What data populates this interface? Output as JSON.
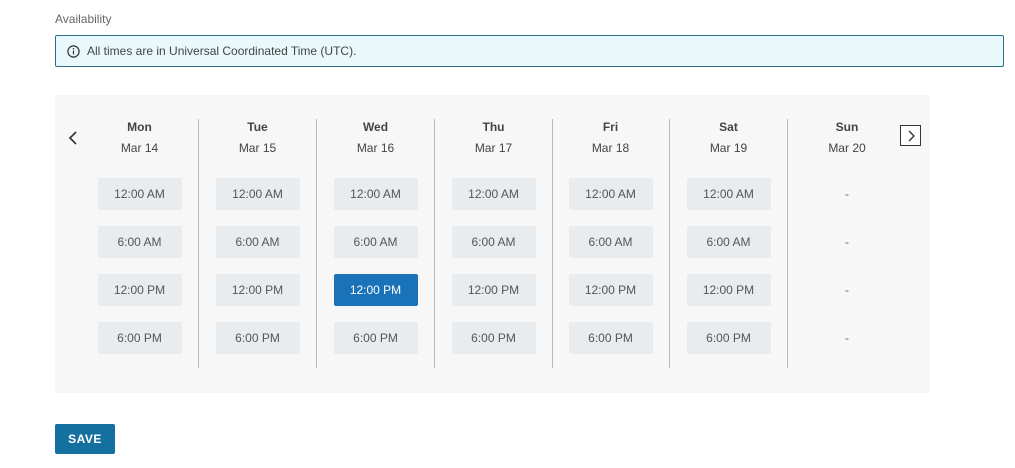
{
  "section_label": "Availability",
  "info_banner": {
    "icon": "info-icon",
    "text": "All times are in Universal Coordinated Time (UTC)."
  },
  "calendar": {
    "prev_icon": "chevron-left-icon",
    "next_icon": "chevron-right-icon",
    "days": [
      {
        "name": "Mon",
        "date": "Mar 14",
        "slots": [
          "12:00 AM",
          "6:00 AM",
          "12:00 PM",
          "6:00 PM"
        ]
      },
      {
        "name": "Tue",
        "date": "Mar 15",
        "slots": [
          "12:00 AM",
          "6:00 AM",
          "12:00 PM",
          "6:00 PM"
        ]
      },
      {
        "name": "Wed",
        "date": "Mar 16",
        "slots": [
          "12:00 AM",
          "6:00 AM",
          "12:00 PM",
          "6:00 PM"
        ],
        "selected_index": 2
      },
      {
        "name": "Thu",
        "date": "Mar 17",
        "slots": [
          "12:00 AM",
          "6:00 AM",
          "12:00 PM",
          "6:00 PM"
        ]
      },
      {
        "name": "Fri",
        "date": "Mar 18",
        "slots": [
          "12:00 AM",
          "6:00 AM",
          "12:00 PM",
          "6:00 PM"
        ]
      },
      {
        "name": "Sat",
        "date": "Mar 19",
        "slots": [
          "12:00 AM",
          "6:00 AM",
          "12:00 PM",
          "6:00 PM"
        ]
      },
      {
        "name": "Sun",
        "date": "Mar 20",
        "slots": [
          "-",
          "-",
          "-",
          "-"
        ],
        "unavailable": true
      }
    ]
  },
  "save_label": "SAVE",
  "colors": {
    "accent": "#1a73b8",
    "banner_bg": "#e8f8fb",
    "banner_border": "#2a6f86",
    "slot_bg": "#e8ecef",
    "save_bg": "#16709f"
  }
}
